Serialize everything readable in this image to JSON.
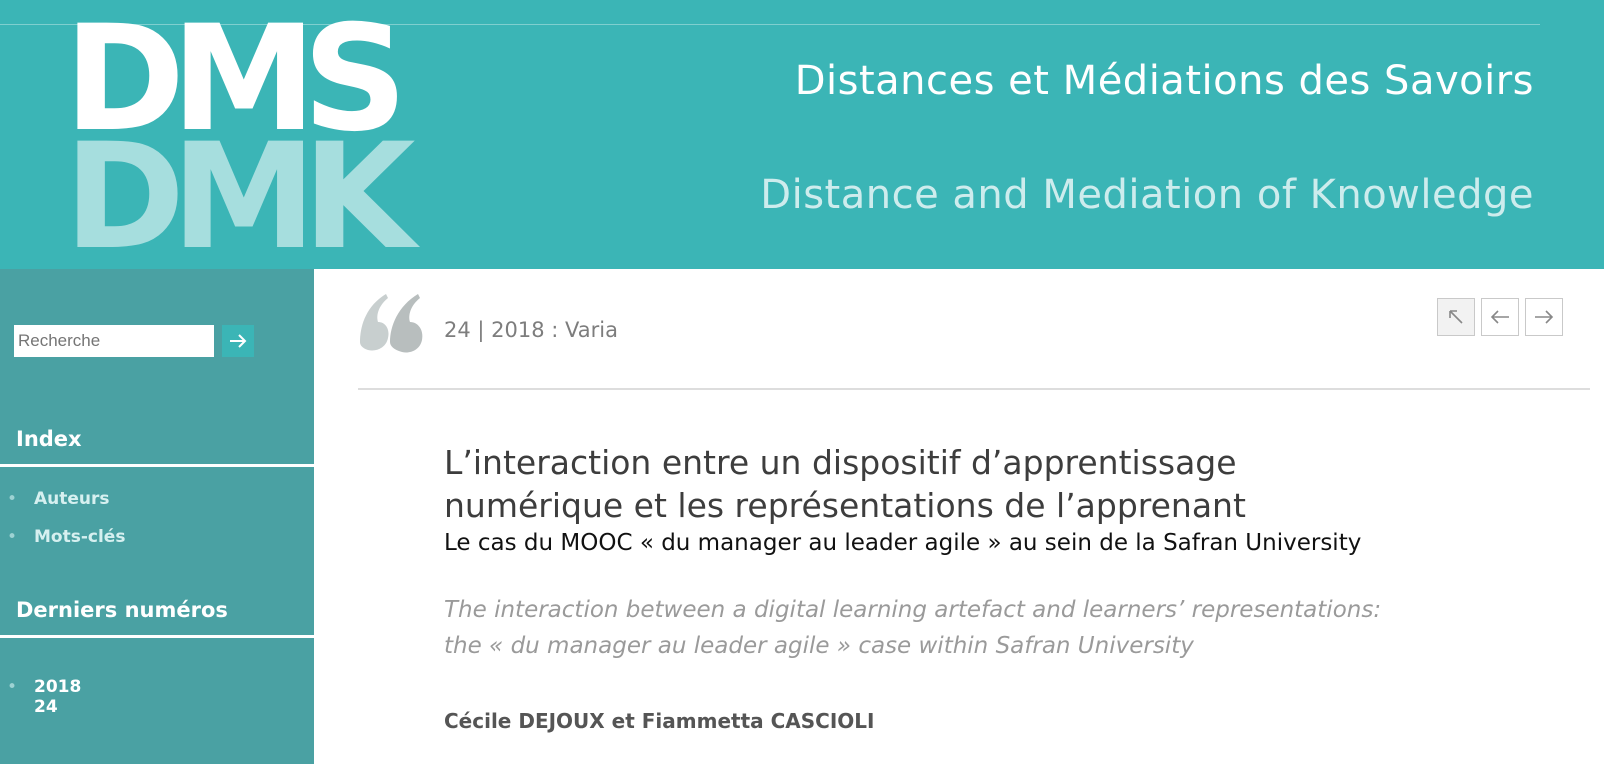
{
  "header": {
    "logo_top": "DMS",
    "logo_bottom": "DMK",
    "title_fr": "Distances et Médiations des Savoirs",
    "title_en": "Distance and Mediation of Knowledge"
  },
  "sidebar": {
    "search_placeholder": "Recherche",
    "index_heading": "Index",
    "index_items": [
      "Auteurs",
      "Mots-clés"
    ],
    "latest_heading": "Derniers numéros",
    "latest_year": "2018",
    "latest_issue": "24"
  },
  "main": {
    "issue_label": "24 | 2018 : Varia",
    "title_line1": "L’interaction entre un dispositif d’apprentissage",
    "title_line2": "numérique et les représentations de l’apprenant",
    "subtitle": "Le cas du MOOC « du manager au leader agile » au sein de la Safran University",
    "alt_title_line1": "The interaction between a digital learning artefact and learners’ representations:",
    "alt_title_line2": "the « du manager au leader agile » case within Safran University",
    "authors": "Cécile DEJOUX et Fiammetta CASCIOLI"
  },
  "colors": {
    "header_bg": "#3bb5b6",
    "sidebar_bg": "#4aa1a3"
  },
  "icons": {
    "search_button": "arrow-right-icon",
    "nav_up": "arrow-up-left-icon",
    "nav_prev": "arrow-left-icon",
    "nav_next": "arrow-right-icon",
    "quote": "quote-mark-icon"
  }
}
